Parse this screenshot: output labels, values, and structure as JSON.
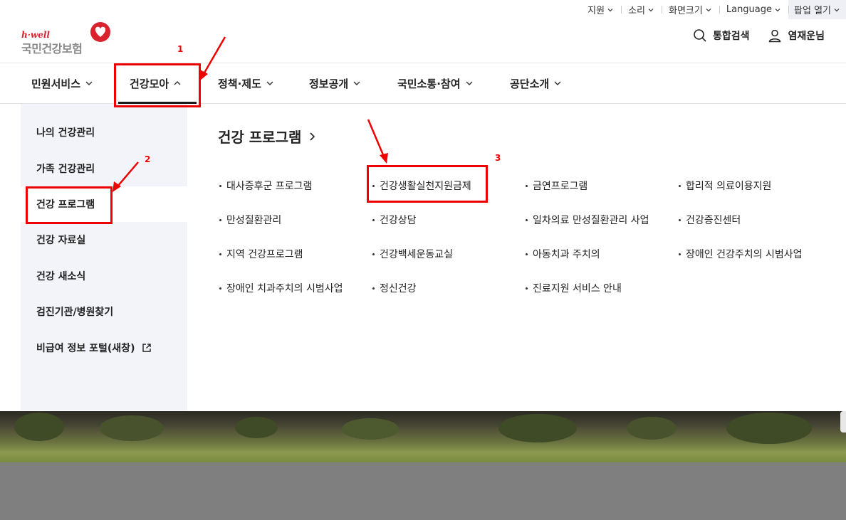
{
  "utility": {
    "support": "지원",
    "sound": "소리",
    "screen_size": "화면크기",
    "language": "Language",
    "popup": "팝업 열기"
  },
  "logo": {
    "tagline": "h·well",
    "name": "국민건강보험"
  },
  "header": {
    "search": "통합검색",
    "user": "염재운님"
  },
  "gnb": [
    {
      "label": "민원서비스",
      "state": "collapsed"
    },
    {
      "label": "건강모아",
      "state": "expanded"
    },
    {
      "label": "정책·제도",
      "state": "collapsed"
    },
    {
      "label": "정보공개",
      "state": "collapsed"
    },
    {
      "label": "국민소통·참여",
      "state": "collapsed"
    },
    {
      "label": "공단소개",
      "state": "collapsed"
    }
  ],
  "lnb": [
    "나의 건강관리",
    "가족 건강관리",
    "건강 프로그램",
    "건강 자료실",
    "건강 새소식",
    "검진기관/병원찾기",
    "비급여 정보 포털(새창)"
  ],
  "content": {
    "title": "건강 프로그램",
    "programs": [
      "대사증후군 프로그램",
      "건강생활실천지원금제",
      "금연프로그램",
      "합리적 의료이용지원",
      "만성질환관리",
      "건강상담",
      "일차의료 만성질환관리 사업",
      "건강증진센터",
      "지역 건강프로그램",
      "건강백세운동교실",
      "아동치과 주치의",
      "장애인 건강주치의 시범사업",
      "장애인 치과주치의 시범사업",
      "정신건강",
      "진료지원 서비스 안내"
    ]
  },
  "annotations": [
    "1",
    "2",
    "3"
  ],
  "colors": {
    "accent": "#d9232e",
    "annotation": "#ee0000",
    "lnb_bg": "#f3f4f9"
  }
}
